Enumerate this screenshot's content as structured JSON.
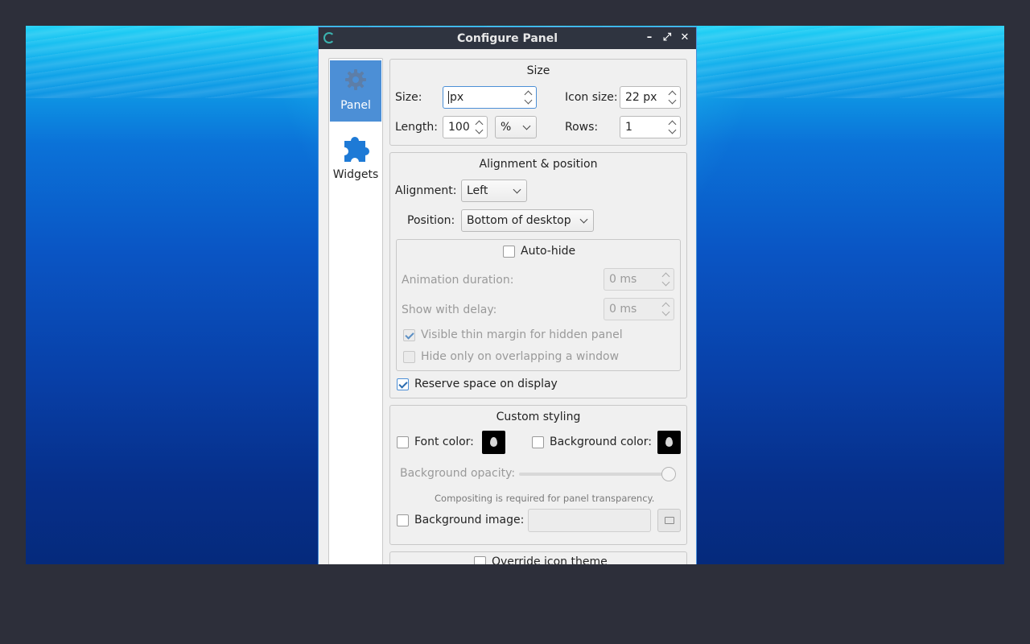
{
  "window": {
    "title": "Configure Panel"
  },
  "sidebar": {
    "items": [
      {
        "label": "Panel",
        "icon": "gear-icon",
        "active": true
      },
      {
        "label": "Widgets",
        "icon": "puzzle-icon",
        "active": false
      }
    ]
  },
  "size_group": {
    "title": "Size",
    "size_label": "Size:",
    "size_value": "px",
    "icon_size_label": "Icon size:",
    "icon_size_value": "22 px",
    "length_label": "Length:",
    "length_value": "100",
    "length_unit": "%",
    "rows_label": "Rows:",
    "rows_value": "1"
  },
  "alignment_group": {
    "title": "Alignment & position",
    "alignment_label": "Alignment:",
    "alignment_value": "Left",
    "position_label": "Position:",
    "position_value": "Bottom of desktop",
    "autohide_label": "Auto-hide",
    "animation_label": "Animation duration:",
    "animation_value": "0 ms",
    "delay_label": "Show with delay:",
    "delay_value": "0 ms",
    "thin_margin_label": "Visible thin margin for hidden panel",
    "overlap_label": "Hide only on overlapping a window",
    "reserve_label": "Reserve space on display"
  },
  "styling_group": {
    "title": "Custom styling",
    "font_color_label": "Font color:",
    "bg_color_label": "Background color:",
    "opacity_label": "Background opacity:",
    "opacity_level": 1.0,
    "compositing_note": "Compositing is required for panel transparency.",
    "bg_image_label": "Background image:"
  },
  "icon_theme_group": {
    "override_label": "Override icon theme"
  },
  "colors": {
    "accent": "#4c8fd6",
    "titlebar": "#2f3440"
  }
}
